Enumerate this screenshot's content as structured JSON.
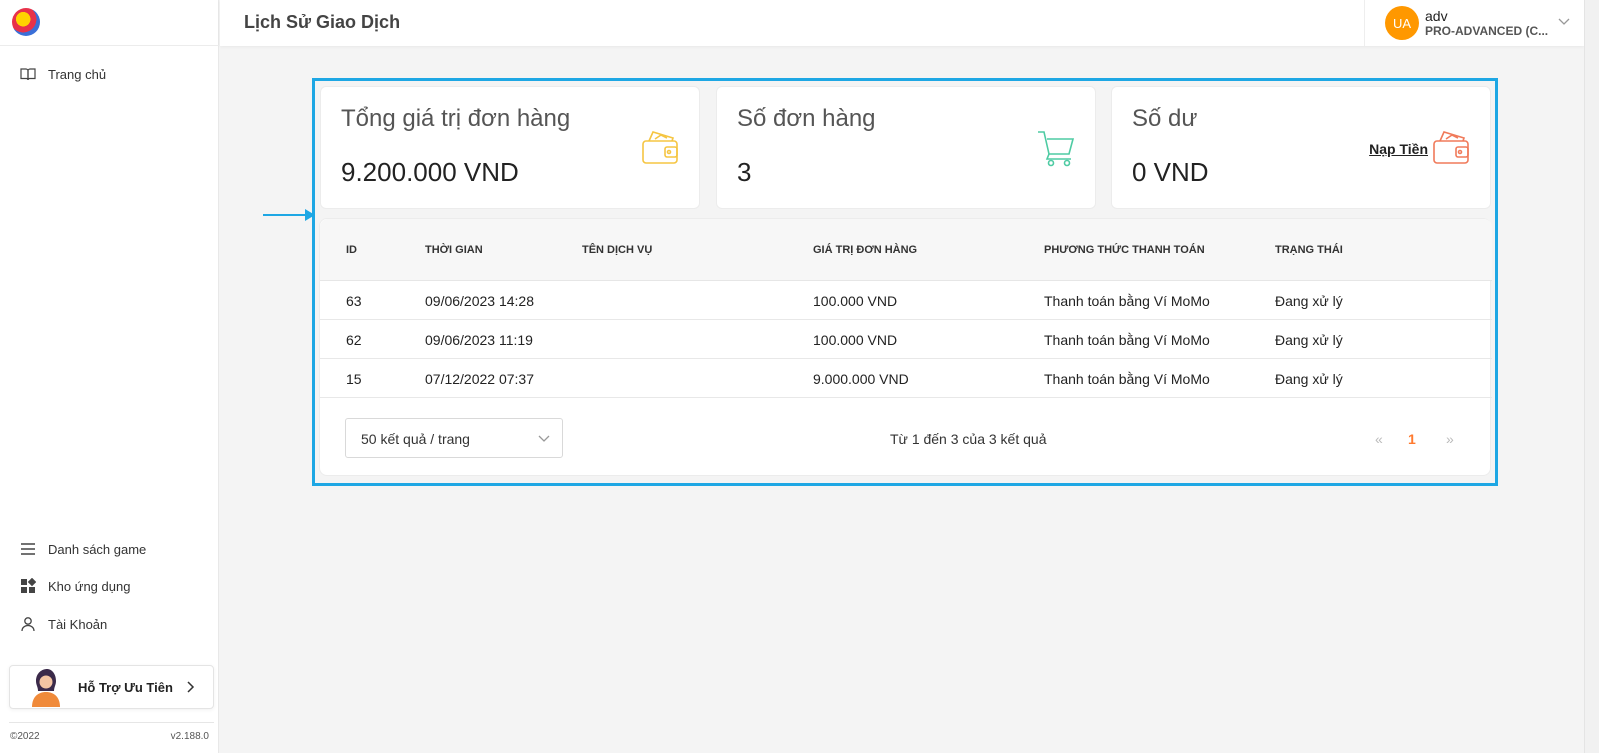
{
  "header": {
    "title": "Lịch Sử Giao Dịch"
  },
  "user": {
    "initials": "UA",
    "name": "adv",
    "plan": "PRO-ADVANCED (C..."
  },
  "sidebar": {
    "top_items": [
      {
        "label": "Trang chủ",
        "icon": "book-icon"
      }
    ],
    "bottom_items": [
      {
        "label": "Danh sách game",
        "icon": "menu-icon"
      },
      {
        "label": "Kho ứng dụng",
        "icon": "apps-icon"
      },
      {
        "label": "Tài Khoản",
        "icon": "user-icon"
      }
    ],
    "support_label": "Hỗ Trợ Ưu Tiên",
    "copyright": "©2022",
    "version": "v2.188.0"
  },
  "stats": {
    "total": {
      "title": "Tổng giá trị đơn hàng",
      "value": "9.200.000 VND",
      "icon": "wallet-icon",
      "color": "#f5c542"
    },
    "orders": {
      "title": "Số đơn hàng",
      "value": "3",
      "icon": "cart-icon",
      "color": "#4ecba3"
    },
    "balance": {
      "title": "Số dư",
      "value": "0 VND",
      "icon": "wallet-icon",
      "color": "#f07a5a",
      "action": "Nạp Tiền"
    }
  },
  "table": {
    "columns": [
      "ID",
      "THỜI GIAN",
      "TÊN DỊCH VỤ",
      "GIÁ TRỊ ĐƠN HÀNG",
      "PHƯƠNG THỨC THANH TOÁN",
      "TRẠNG THÁI"
    ],
    "rows": [
      [
        "63",
        "09/06/2023 14:28",
        "",
        "100.000 VND",
        "Thanh toán bằng Ví MoMo",
        "Đang xử lý"
      ],
      [
        "62",
        "09/06/2023 11:19",
        "",
        "100.000 VND",
        "Thanh toán bằng Ví MoMo",
        "Đang xử lý"
      ],
      [
        "15",
        "07/12/2022 07:37",
        "",
        "9.000.000 VND",
        "Thanh toán bằng Ví MoMo",
        "Đang xử lý"
      ]
    ]
  },
  "pagination": {
    "page_size": "50 kết quả / trang",
    "range_text": "Từ 1 đến 3 của 3 kết quả",
    "prev": "«",
    "current": "1",
    "next": "»",
    "active_color": "#ff7a2f"
  },
  "accent_color": "#1ea7e4"
}
